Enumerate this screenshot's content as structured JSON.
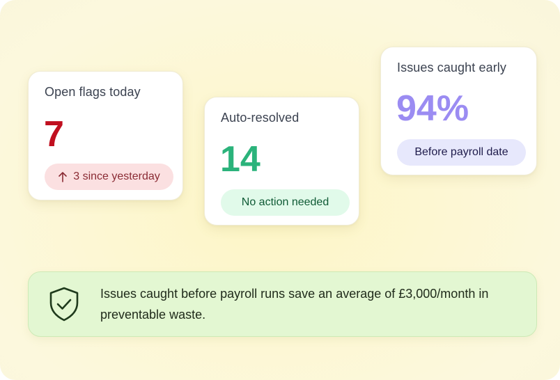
{
  "cards": {
    "open_flags": {
      "title": "Open flags today",
      "value": "7",
      "badge": "3 since yesterday",
      "badge_icon": "arrow-up-icon",
      "value_color": "#c00f1f"
    },
    "auto_resolved": {
      "title": "Auto-resolved",
      "value": "14",
      "badge": "No action needed",
      "value_color": "#2bb37b"
    },
    "caught_early": {
      "title": "Issues caught early",
      "value": "94%",
      "badge": "Before payroll date",
      "value_color": "#9b8cf2"
    }
  },
  "banner": {
    "icon": "shield-check-icon",
    "text": "Issues caught before payroll runs save an average of £3,000/month in preventable waste."
  }
}
